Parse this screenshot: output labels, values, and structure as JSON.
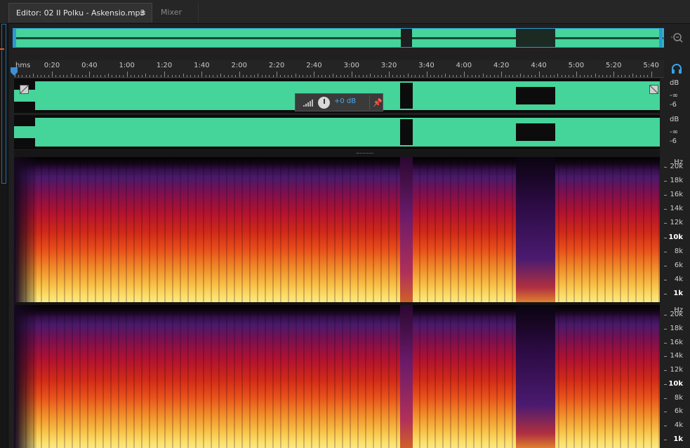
{
  "tabs": {
    "editor_label": "Editor: 02 II Polku - Askensio.mp3",
    "editor_menu_glyph": "≡",
    "mixer_label": "Mixer"
  },
  "overview": {
    "zoom_icon": "zoom-magnifier-icon"
  },
  "ruler": {
    "unit": "hms",
    "labels": [
      "0:20",
      "0:40",
      "1:00",
      "1:20",
      "1:40",
      "2:00",
      "2:20",
      "2:40",
      "3:00",
      "3:20",
      "3:40",
      "4:00",
      "4:20",
      "4:40",
      "5:00",
      "5:20",
      "5:40"
    ]
  },
  "hud": {
    "gain": "+0 dB",
    "pin_icon": "pin-icon"
  },
  "amplitude_scale": {
    "ch1": {
      "unit": "dB",
      "a": "-∞",
      "b": "-6"
    },
    "ch2": {
      "unit": "dB",
      "a": "-∞",
      "b": "-6"
    }
  },
  "frequency_scale": {
    "unit": "Hz",
    "labels": [
      "20k",
      "18k",
      "16k",
      "14k",
      "12k",
      "10k",
      "8k",
      "6k",
      "4k",
      "1k"
    ]
  },
  "colors": {
    "waveform": "#45d49a",
    "accent": "#2a9ad6",
    "gain_text": "#4aa8e8"
  }
}
